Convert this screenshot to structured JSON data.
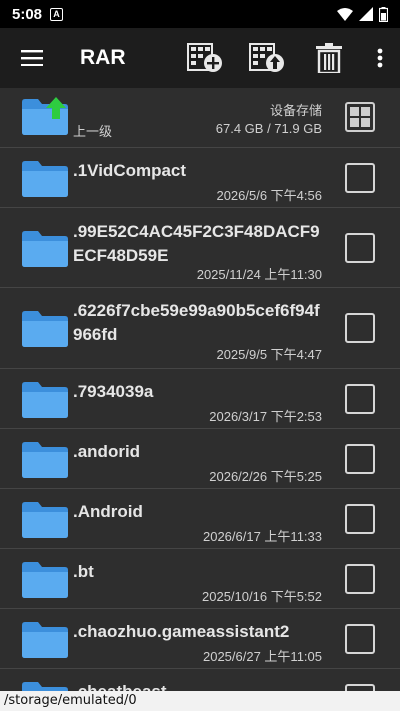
{
  "status_bar": {
    "time": "5:08",
    "notification_badge": "A"
  },
  "app_bar": {
    "title": "RAR",
    "icons": [
      "menu-icon",
      "archive-add-icon",
      "archive-extract-icon",
      "trash-icon",
      "more-vert-icon"
    ]
  },
  "up_row": {
    "label": "上一级",
    "storage_title": "设备存储",
    "storage_size": "67.4 GB / 71.9 GB"
  },
  "files": [
    {
      "name": ".1VidCompact",
      "date": "2026/5/6 下午4:56"
    },
    {
      "name": ".99E52C4AC45F2C3F48DACF9ECF48D59E",
      "date": "2025/11/24 上午11:30"
    },
    {
      "name": ".6226f7cbe59e99a90b5cef6f94f966fd",
      "date": "2025/9/5 下午4:47"
    },
    {
      "name": ".7934039a",
      "date": "2026/3/17 下午2:53"
    },
    {
      "name": ".andorid",
      "date": "2026/2/26 下午5:25"
    },
    {
      "name": ".Android",
      "date": "2026/6/17 上午11:33"
    },
    {
      "name": ".bt",
      "date": "2025/10/16 下午5:52"
    },
    {
      "name": ".chaozhuo.gameassistant2",
      "date": "2025/6/27 上午11:05"
    },
    {
      "name": ".cheatbeast",
      "date": ""
    }
  ],
  "path_bar": {
    "path": "/storage/emulated/0"
  },
  "colors": {
    "folder": "#5aabf0",
    "folder_dark": "#3c8fdc",
    "up_arrow": "#2ecc40",
    "background": "#2e2e2e",
    "app_bar": "#1d1d1d"
  }
}
